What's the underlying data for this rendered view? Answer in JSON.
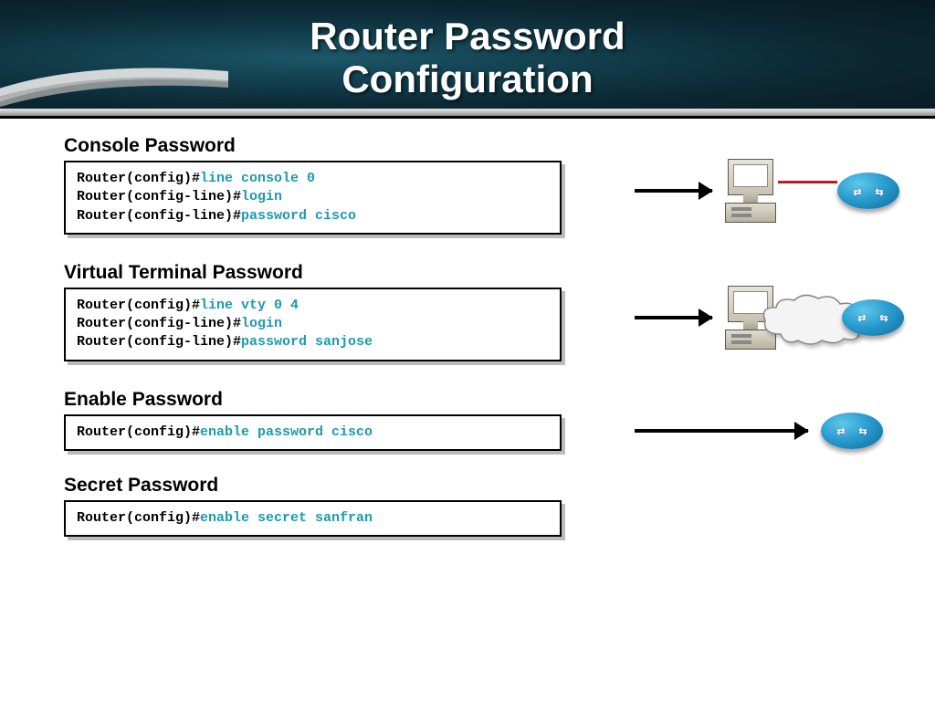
{
  "title_line1": "Router Password",
  "title_line2": "Configuration",
  "sections": [
    {
      "heading": "Console Password",
      "lines": [
        {
          "prompt": "Router(config)#",
          "cmd": "line console 0"
        },
        {
          "prompt": "Router(config-line)#",
          "cmd": "login"
        },
        {
          "prompt": "Router(config-line)#",
          "cmd": "password cisco"
        }
      ]
    },
    {
      "heading": "Virtual Terminal Password",
      "lines": [
        {
          "prompt": "Router(config)#",
          "cmd": "line vty 0 4"
        },
        {
          "prompt": "Router(config-line)#",
          "cmd": "login"
        },
        {
          "prompt": "Router(config-line)#",
          "cmd": "password sanjose"
        }
      ]
    },
    {
      "heading": "Enable Password",
      "lines": [
        {
          "prompt": "Router(config)#",
          "cmd": "enable password cisco"
        }
      ]
    },
    {
      "heading": "Secret Password",
      "lines": [
        {
          "prompt": "Router(config)#",
          "cmd": "enable secret sanfran"
        }
      ]
    }
  ],
  "icons": {
    "computer": "desktop-computer",
    "router": "network-router",
    "cloud": "network-cloud"
  },
  "colors": {
    "command": "#1b9aae",
    "cable": "#c81818",
    "router_fill": "#2a9cd0"
  }
}
